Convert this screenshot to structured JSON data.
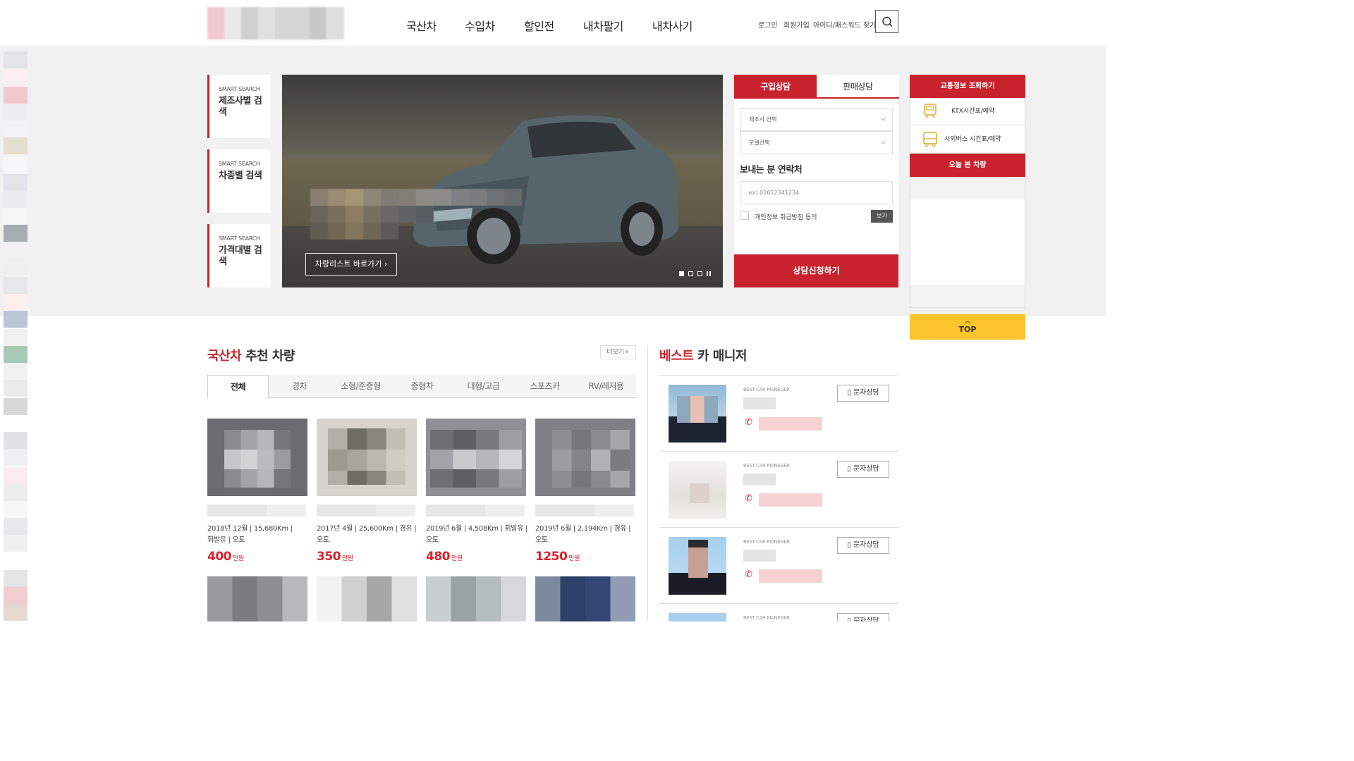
{
  "header": {
    "nav": [
      "국산차",
      "수입차",
      "할인전",
      "내차팔기",
      "내차사기"
    ],
    "util": [
      "로그인",
      "회원가입",
      "아이디/패스워드 찾기"
    ]
  },
  "smart_search": [
    {
      "sub": "SMART SEARCH",
      "title": "제조사별 검색"
    },
    {
      "sub": "SMART SEARCH",
      "title": "차종별 검색"
    },
    {
      "sub": "SMART SEARCH",
      "title": "가격대별 검색"
    }
  ],
  "banner": {
    "button": "차량리스트 바로가기"
  },
  "consult": {
    "tabs": [
      "구입상담",
      "판매상담"
    ],
    "maker_select": "제조사 선택",
    "model_select": "모델선택",
    "contact_label": "보내는 분 연락처",
    "phone_placeholder": "ex) 01012341234",
    "privacy_label": "개인정보 취급방침 동의",
    "view_button": "보기",
    "submit": "상담신청하기"
  },
  "quick": {
    "traffic": "교통정보 조회하기",
    "ktx": "KTX시간표/예약",
    "bus": "시외버스 시간표/예약",
    "today": "오늘 본 차량",
    "top": "TOP"
  },
  "recommend": {
    "title_accent": "국산차",
    "title_rest": " 추천 차량",
    "more": "더보기+",
    "categories": [
      "전체",
      "경차",
      "소형/준중형",
      "중형차",
      "대형/고급",
      "스포츠카",
      "RV/레저용"
    ],
    "cars": [
      {
        "spec1": "2018년 12월 | 15,680Km |",
        "spec2": "휘발유 | 오토",
        "price": "400",
        "unit": "만원"
      },
      {
        "spec1": "2017년 4월 | 25,600Km | 경유 |",
        "spec2": "오토",
        "price": "350",
        "unit": "만원"
      },
      {
        "spec1": "2019년 6월 | 4,508Km | 휘발유 |",
        "spec2": "오토",
        "price": "480",
        "unit": "만원"
      },
      {
        "spec1": "2019년 6월 | 2,194Km | 경유 |",
        "spec2": "오토",
        "price": "1250",
        "unit": "만원"
      }
    ]
  },
  "managers": {
    "title_accent": "베스트",
    "title_rest": " 카 매니저",
    "label": "BEST CAR MANEGER",
    "sms": "문자상담"
  },
  "colors": {
    "brand_red": "#c8232c",
    "top_yellow": "#fbc42c"
  }
}
